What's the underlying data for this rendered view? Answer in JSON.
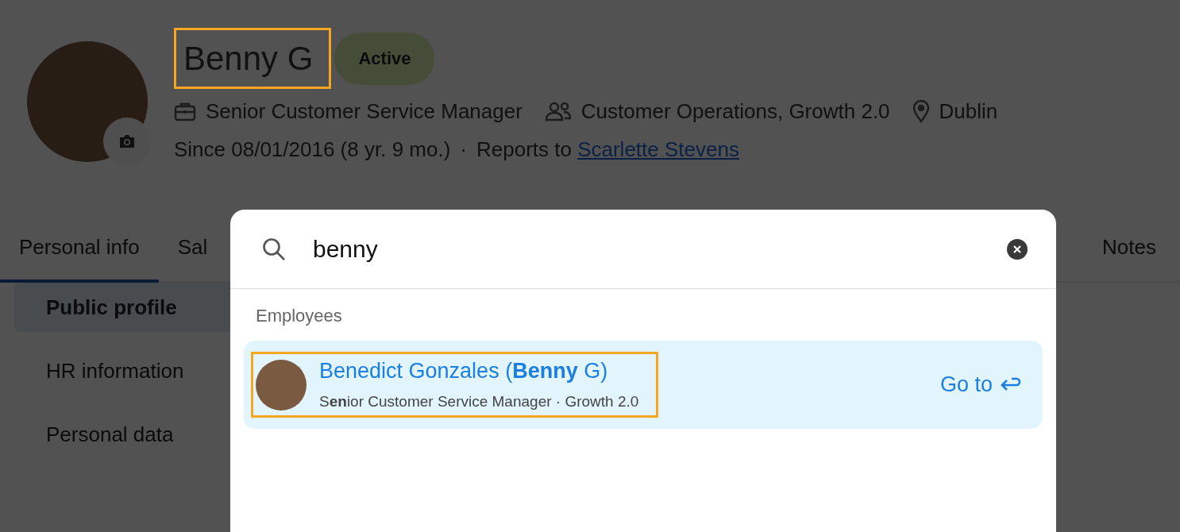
{
  "profile": {
    "name": "Benny G",
    "status": "Active",
    "meta": [
      {
        "kind": "job",
        "text": "Senior Customer Service Manager"
      },
      {
        "kind": "team",
        "text": "Customer Operations, Growth 2.0"
      },
      {
        "kind": "location",
        "text": "Dublin"
      }
    ],
    "since": "Since 08/01/2016 (8 yr. 9 mo.)",
    "separator": "·",
    "reports_label": "Reports to",
    "manager_link": "Scarlette Stevens"
  },
  "tabs": [
    {
      "label": "Personal info",
      "selected": true
    },
    {
      "label": "Sal",
      "selected": false
    },
    {
      "label": "Notes",
      "selected": false
    }
  ],
  "sidebar": {
    "items": [
      {
        "label": "Public profile",
        "selected": true
      },
      {
        "label": "HR information",
        "selected": false
      },
      {
        "label": "Personal data",
        "selected": false
      }
    ]
  },
  "search": {
    "value": "benny",
    "section": "Employees",
    "results": [
      {
        "name": "Benedict Gonzales (**Benny** G)",
        "subtitle": "S**en**ior Customer Service Manager · Growth 2.0",
        "action": "Go to",
        "selected": true
      }
    ]
  }
}
